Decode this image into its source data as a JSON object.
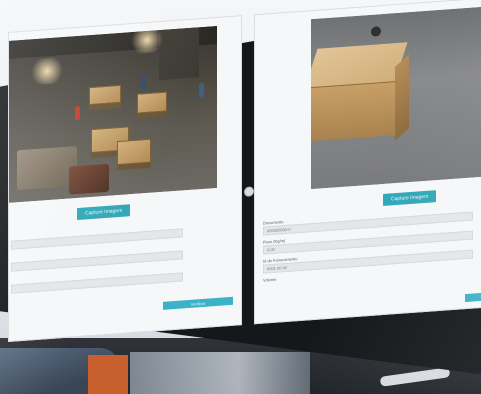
{
  "left_panel": {
    "capture_label": "Capture Imagem",
    "fields": [
      {
        "label": "",
        "value": ""
      },
      {
        "label": "",
        "value": ""
      },
      {
        "label": "",
        "value": ""
      }
    ],
    "submit_label": "Verificar"
  },
  "right_panel": {
    "capture_label": "Capture Imagem",
    "fields": [
      {
        "label": "Documento",
        "value": "000000000-0"
      },
      {
        "label": "Peso (Kg/m)",
        "value": "0,00"
      },
      {
        "label": "Id do Fornecimento",
        "value": "0001 00 00"
      },
      {
        "label": "Volume",
        "value": ""
      }
    ],
    "submit_label": ""
  },
  "colors": {
    "accent": "#33a8b8",
    "bezel": "#15171a",
    "panel_bg": "#f6f7f9"
  },
  "icons": {
    "nav_knob": "circle-handle-icon"
  }
}
